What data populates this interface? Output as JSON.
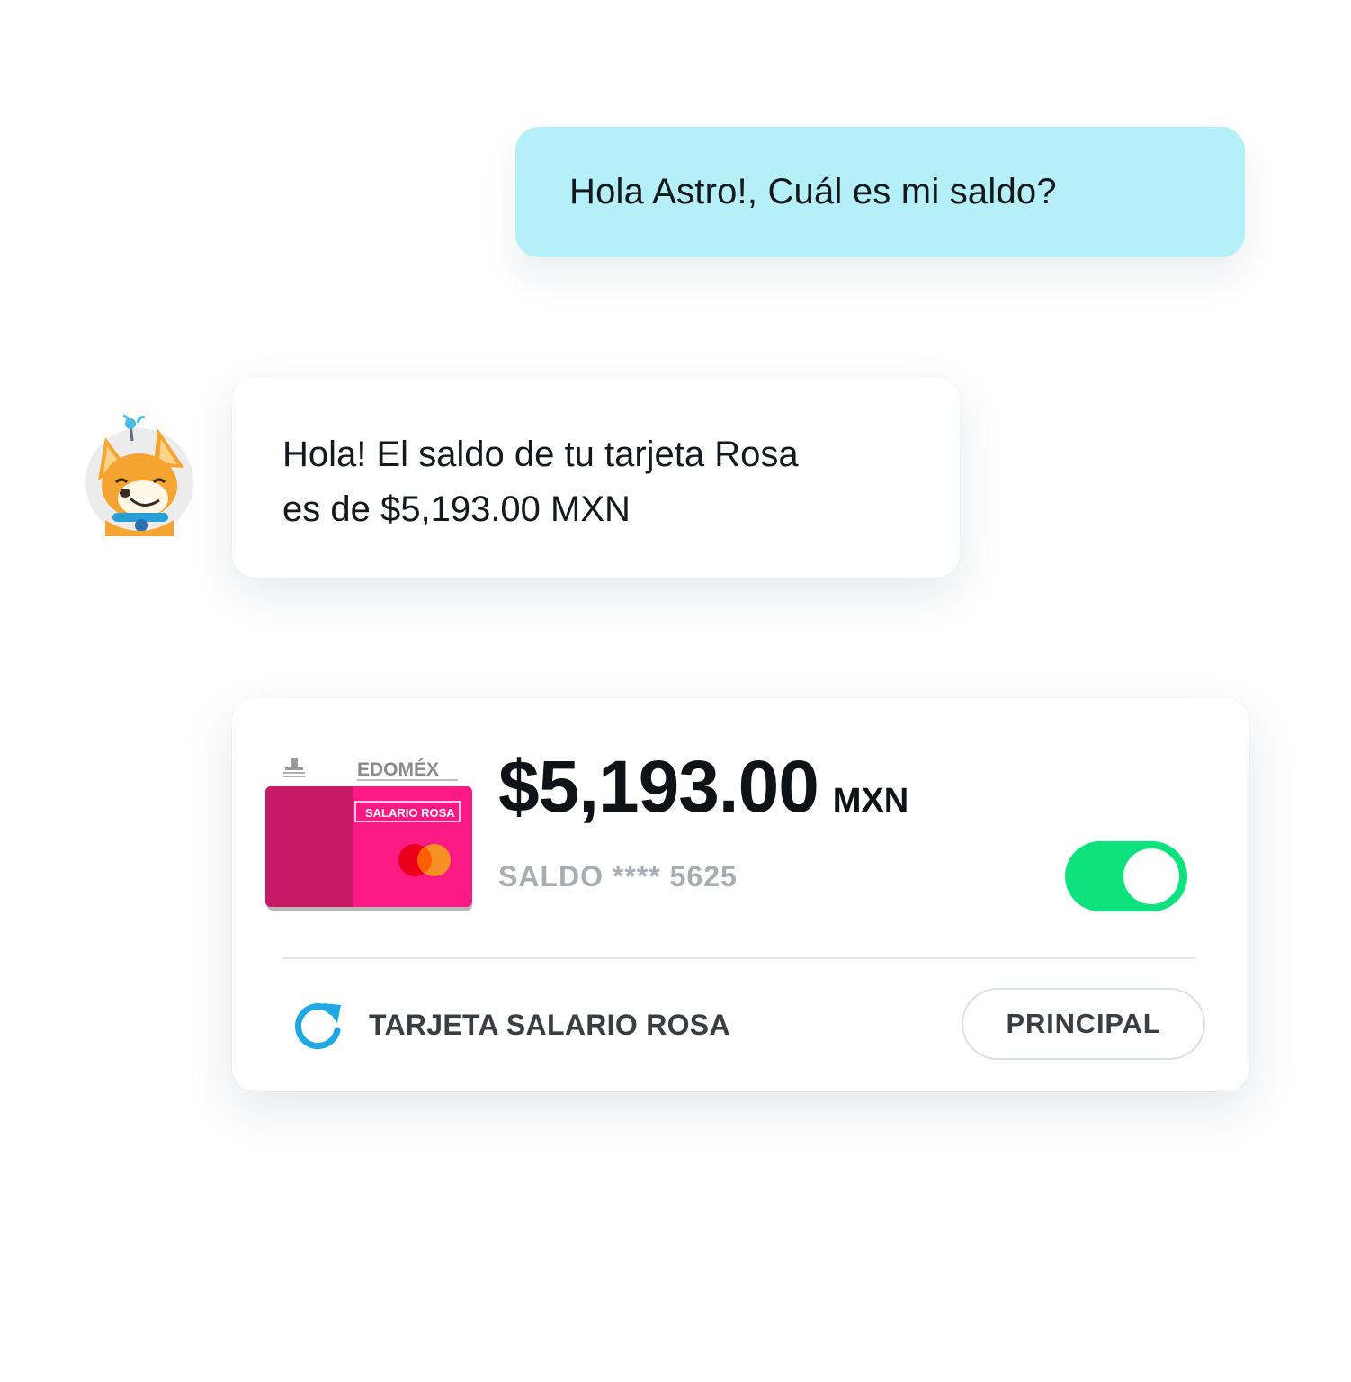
{
  "chat": {
    "user_message": "Hola Astro!, Cuál es mi saldo?",
    "bot_message_line1": "Hola! El saldo de tu tarjeta Rosa",
    "bot_message_line2": "es de $5,193.00 MXN",
    "bot_avatar_icon": "corgi-assistant-icon"
  },
  "balance": {
    "amount": "$5,193.00",
    "currency": "MXN",
    "saldo_label": "SALDO **** 5625",
    "toggle_on": true,
    "card_name": "TARJETA SALARIO ROSA",
    "principal_label": "PRINCIPAL"
  },
  "card_art": {
    "brand": "EDOMÉX",
    "card_label": "SALARIO ROSA",
    "network_icon": "mastercard-icon"
  },
  "colors": {
    "user_bubble": "#b5f0f8",
    "toggle_on": "#0ee27e",
    "card_dark_pink": "#c71a66",
    "card_pink": "#fb1a83",
    "refresh_icon": "#1fa7e6"
  }
}
